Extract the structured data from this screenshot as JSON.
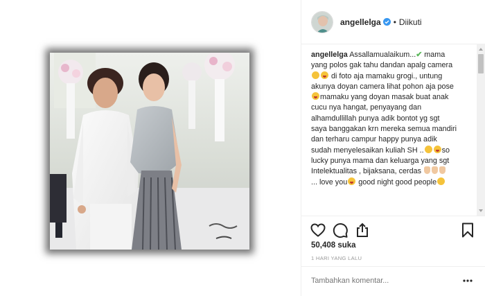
{
  "header": {
    "username": "angellelga",
    "separator": "•",
    "follow_status": "Diikuti"
  },
  "caption": {
    "username": "angellelga",
    "lines": [
      "Assallamualaikum...",
      "yang polos gak tahu dandan apalg camera",
      "di foto aja mamaku grogi., untung",
      "akunya doyan camera lihat pohon aja pose",
      "mamaku yang doyan masak buat anak",
      "cucu nya hangat, penyayang dan",
      "alhamdullillah punya adik bontot yg sgt",
      "saya banggakan krn mereka semua mandiri",
      "dan terharu campur happy punya adik",
      "sudah menyelesaikan kuliah SH ..",
      "lucky punya mama dan keluarga yang sgt",
      "Intelektualitas , bijaksana, cerdas",
      "... love you",
      "good night good people"
    ],
    "line1_tail": "mama",
    "line10_tail": "so"
  },
  "stats": {
    "likes": "50,408 suka",
    "time_ago": "1 HARI YANG LALU"
  },
  "comment": {
    "placeholder": "Tambahkan komentar..."
  },
  "icons": {
    "like": "heart-icon",
    "comment": "comment-icon",
    "share": "share-icon",
    "save": "bookmark-icon",
    "more": "more-options-icon",
    "verified": "verified-badge-icon"
  },
  "colors": {
    "verified_blue": "#3897f0",
    "text": "#262626",
    "muted": "#999999",
    "border": "#efefef"
  }
}
